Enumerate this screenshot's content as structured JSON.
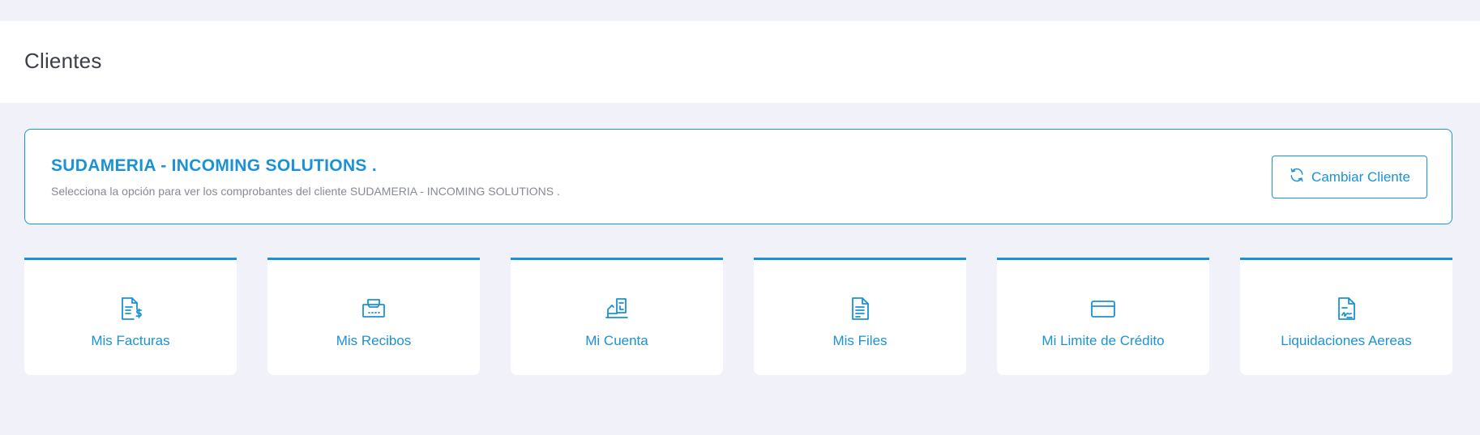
{
  "header": {
    "title": "Clientes"
  },
  "client": {
    "name": "SUDAMERIA - INCOMING SOLUTIONS .",
    "description": "Selecciona la opción para ver los comprobantes del cliente SUDAMERIA - INCOMING SOLUTIONS .",
    "change_button_label": "Cambiar Cliente",
    "change_button_icon": "refresh-icon"
  },
  "tiles": [
    {
      "label": "Mis Facturas",
      "icon": "invoice-dollar-icon"
    },
    {
      "label": "Mis Recibos",
      "icon": "receipt-printer-icon"
    },
    {
      "label": "Mi Cuenta",
      "icon": "cash-register-icon"
    },
    {
      "label": "Mis Files",
      "icon": "document-icon"
    },
    {
      "label": "Mi Limite de Crédito",
      "icon": "credit-card-icon"
    },
    {
      "label": "Liquidaciones Aereas",
      "icon": "signed-document-icon"
    }
  ],
  "colors": {
    "accent": "#1b92d6",
    "background": "#f1f2f9",
    "title_text": "#3c3f47",
    "muted_text": "#868a93"
  }
}
